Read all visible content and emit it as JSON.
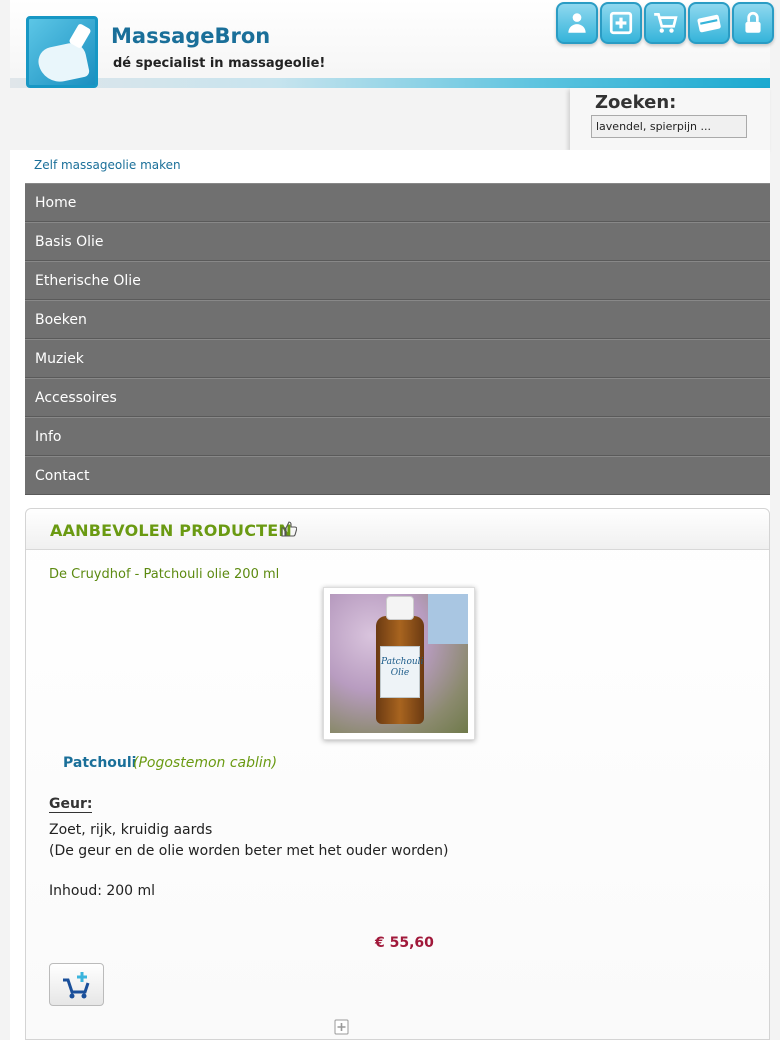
{
  "header": {
    "brand_name": "MassageBron",
    "tagline": "dé specialist in massageolie!",
    "icons": [
      "account-icon",
      "add-icon",
      "cart-icon",
      "checkout-icon",
      "lock-icon"
    ],
    "accent": "#35b4da"
  },
  "search": {
    "title": "Zoeken:",
    "placeholder": "lavendel, spierpijn ..."
  },
  "breadcrumb": "Zelf massageolie maken",
  "nav": {
    "items": [
      {
        "label": "Home"
      },
      {
        "label": "Basis Olie"
      },
      {
        "label": "Etherische Olie"
      },
      {
        "label": "Boeken"
      },
      {
        "label": "Muziek"
      },
      {
        "label": "Accessoires"
      },
      {
        "label": "Info"
      },
      {
        "label": "Contact"
      }
    ]
  },
  "recommended": {
    "title": "AANBEVOLEN PRODUCTEN",
    "product": {
      "link": "De Cruydhof - Patchouli olie 200 ml",
      "bottle_label": "Patchouli Olie",
      "name": "Patchouli",
      "latin": "(Pogostemon cablin)",
      "geur_label": "Geur:",
      "geur_line1": "Zoet, rijk, kruidig aards",
      "geur_line2": "(De geur en de olie worden beter met het ouder worden)",
      "inhoud": "Inhoud: 200 ml",
      "price": "€ 55,60",
      "price_color": "#a0183a"
    }
  }
}
